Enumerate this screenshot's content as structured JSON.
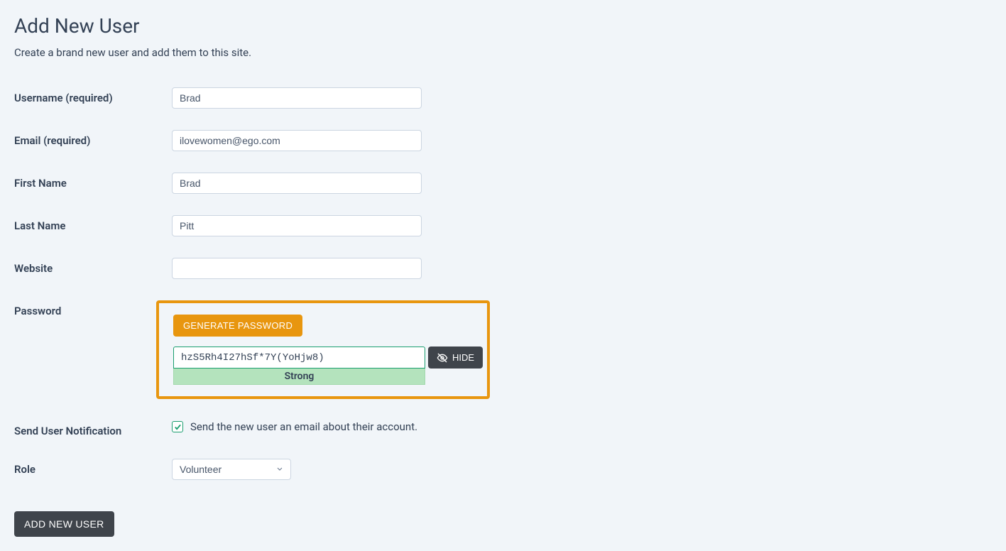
{
  "page": {
    "title": "Add New User",
    "subtitle": "Create a brand new user and add them to this site."
  },
  "form": {
    "username": {
      "label": "Username (required)",
      "value": "Brad"
    },
    "email": {
      "label": "Email (required)",
      "value": "ilovewomen@ego.com"
    },
    "first_name": {
      "label": "First Name",
      "value": "Brad"
    },
    "last_name": {
      "label": "Last Name",
      "value": "Pitt"
    },
    "website": {
      "label": "Website",
      "value": ""
    },
    "password": {
      "label": "Password",
      "generate_label": "GENERATE PASSWORD",
      "value": "hzS5Rh4I27hSf*7Y(YoHjw8)",
      "strength": "Strong",
      "hide_label": "HIDE"
    },
    "notification": {
      "label": "Send User Notification",
      "checkbox_label": "Send the new user an email about their account.",
      "checked": true
    },
    "role": {
      "label": "Role",
      "selected": "Volunteer"
    },
    "submit_label": "ADD NEW USER"
  }
}
